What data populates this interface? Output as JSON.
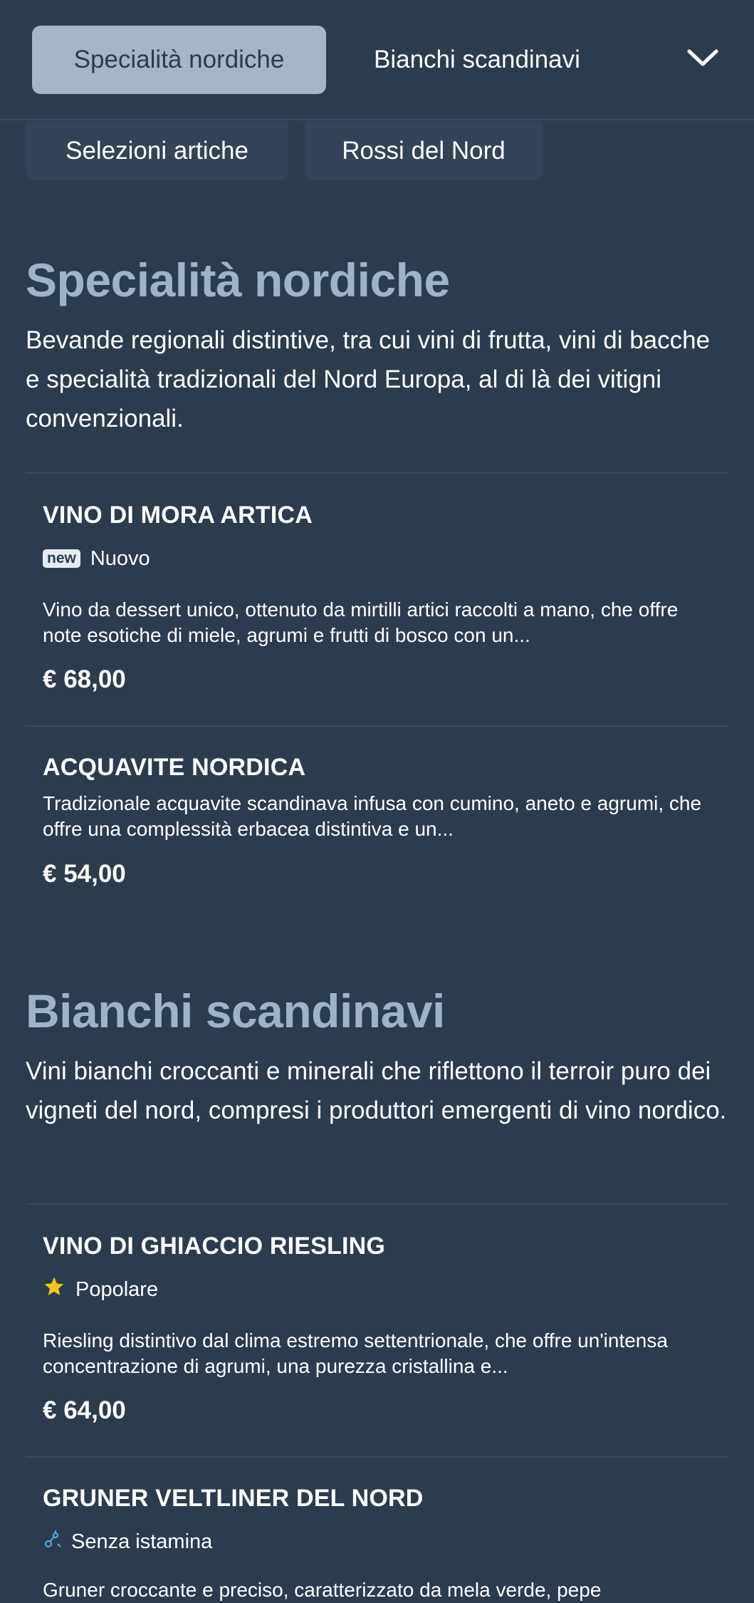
{
  "header": {
    "tabs": [
      "Specialità nordiche",
      "Bianchi scandinavi"
    ],
    "active_tab": 0
  },
  "chips": [
    "Selezioni artiche",
    "Rossi del Nord"
  ],
  "sections": [
    {
      "title": "Specialità nordiche",
      "description": "Bevande regionali distintive, tra cui vini di frutta, vini di bacche e specialità tradizionali del Nord Europa, al di là dei vitigni convenzionali.",
      "items": [
        {
          "name": "VINO DI MORA ARTICA",
          "badge": {
            "type": "new",
            "label": "new",
            "text": "Nuovo"
          },
          "description": "Vino da dessert unico, ottenuto da mirtilli artici raccolti a mano, che offre note esotiche di miele, agrumi e frutti di bosco con un...",
          "price": "€ 68,00"
        },
        {
          "name": "ACQUAVITE NORDICA",
          "description": "Tradizionale acquavite scandinava infusa con cumino, aneto e agrumi, che offre una complessità erbacea distintiva e un...",
          "price": "€ 54,00"
        }
      ]
    },
    {
      "title": "Bianchi scandinavi",
      "description": "Vini bianchi croccanti e minerali che riflettono il terroir puro dei vigneti del nord, compresi i produttori emergenti di vino nordico.",
      "items": [
        {
          "name": "VINO DI GHIACCIO RIESLING",
          "badge": {
            "type": "star",
            "icon": "star-icon",
            "text": "Popolare"
          },
          "description": "Riesling distintivo dal clima estremo settentrionale, che offre un'intensa concentrazione di agrumi, una purezza cristallina e...",
          "price": "€ 64,00"
        },
        {
          "name": "GRUNER VELTLINER DEL NORD",
          "badge": {
            "type": "histamine",
            "icon": "histamine-free-icon",
            "text": "Senza istamina"
          },
          "description": "Gruner croccante e preciso, caratterizzato da mela verde, pepe",
          "price": ""
        }
      ]
    }
  ],
  "colors": {
    "background": "#2d3b4e",
    "tab_active_bg": "#a4b6c8",
    "section_title": "#9fb3c8",
    "star": "#f5c518",
    "histamine_icon": "#4fb3e8"
  }
}
